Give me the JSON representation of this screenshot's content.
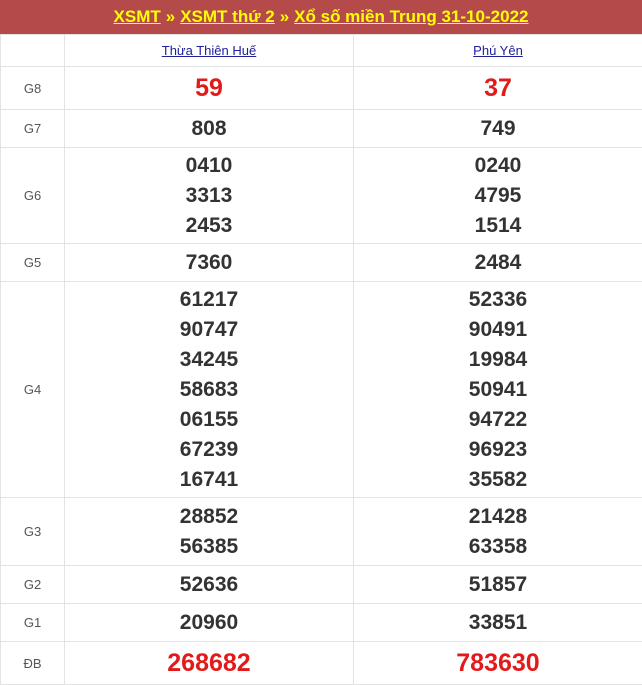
{
  "header": {
    "link_xsmt": "XSMT",
    "separator": "»",
    "link_weekday": "XSMT thứ 2",
    "link_title": "Xổ số miền Trung 31-10-2022",
    "color_bg": "#b54a4b",
    "color_text": "#ffff00"
  },
  "provinces": [
    "Thừa Thiên Huế",
    "Phú Yên"
  ],
  "colors": {
    "special_red": "#e21a1a",
    "number_dark": "#333333",
    "label_gray": "#555555"
  },
  "rows": [
    {
      "label": "G8",
      "values": [
        [
          "59"
        ],
        [
          "37"
        ]
      ]
    },
    {
      "label": "G7",
      "values": [
        [
          "808"
        ],
        [
          "749"
        ]
      ]
    },
    {
      "label": "G6",
      "values": [
        [
          "0410",
          "3313",
          "2453"
        ],
        [
          "0240",
          "4795",
          "1514"
        ]
      ]
    },
    {
      "label": "G5",
      "values": [
        [
          "7360"
        ],
        [
          "2484"
        ]
      ]
    },
    {
      "label": "G4",
      "values": [
        [
          "61217",
          "90747",
          "34245",
          "58683",
          "06155",
          "67239",
          "16741"
        ],
        [
          "52336",
          "90491",
          "19984",
          "50941",
          "94722",
          "96923",
          "35582"
        ]
      ]
    },
    {
      "label": "G3",
      "values": [
        [
          "28852",
          "56385"
        ],
        [
          "21428",
          "63358"
        ]
      ]
    },
    {
      "label": "G2",
      "values": [
        [
          "52636"
        ],
        [
          "51857"
        ]
      ]
    },
    {
      "label": "G1",
      "values": [
        [
          "20960"
        ],
        [
          "33851"
        ]
      ]
    },
    {
      "label": "ĐB",
      "values": [
        [
          "268682"
        ],
        [
          "783630"
        ]
      ]
    }
  ]
}
